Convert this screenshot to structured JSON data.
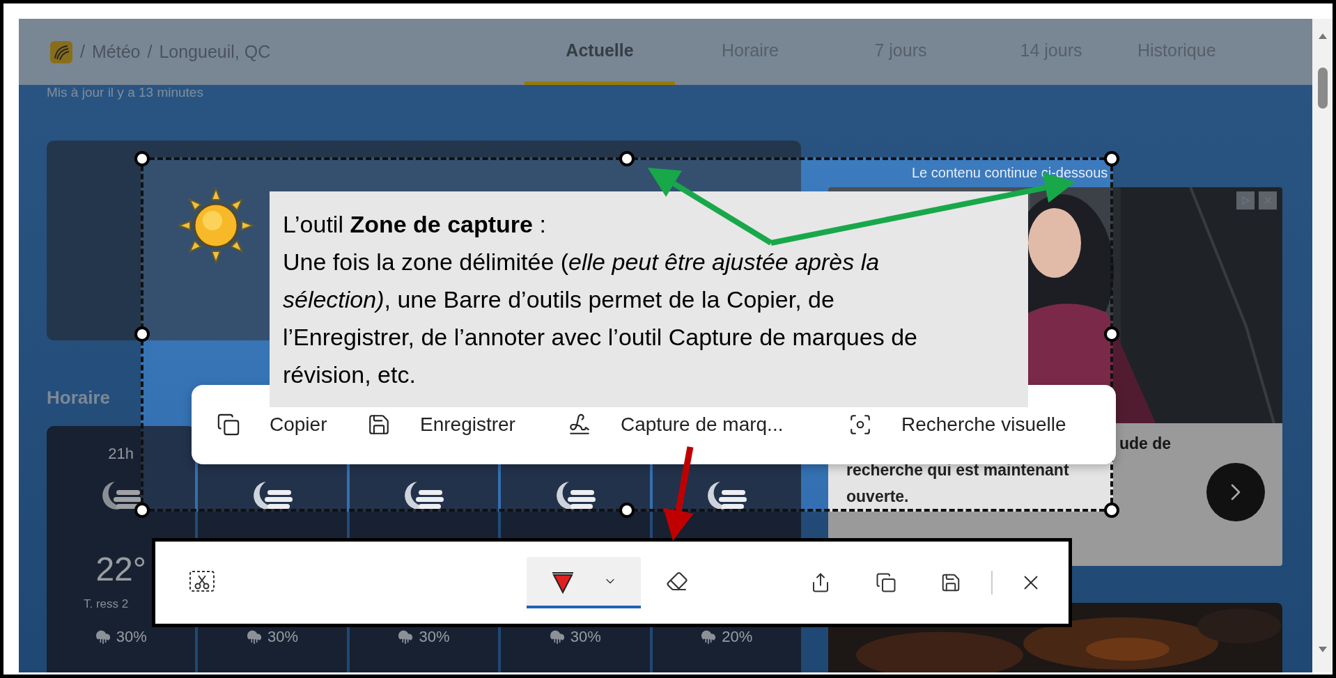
{
  "header": {
    "breadcrumb": {
      "separator": "/",
      "items": [
        "Météo",
        "Longueuil, QC"
      ]
    },
    "tabs": [
      {
        "label": "Actuelle",
        "selected": true
      },
      {
        "label": "Horaire",
        "selected": false
      },
      {
        "label": "7 jours",
        "selected": false
      },
      {
        "label": "14 jours",
        "selected": false
      },
      {
        "label": "Historique",
        "selected": false
      }
    ]
  },
  "updated": "Mis à jour il y a 13 minutes",
  "hourly": {
    "title": "Horaire",
    "hours": [
      {
        "time": "21h",
        "temp": "22°",
        "feels": "T. ress 2",
        "precip": "30%"
      },
      {
        "precip": "30%"
      },
      {
        "precip": "30%"
      },
      {
        "precip": "30%"
      },
      {
        "precip": "20%"
      }
    ]
  },
  "side_note": "Le contenu continue ci-dessous",
  "ad": {
    "lines": [
      "ude de",
      "recherche qui est maintenant",
      "ouverte."
    ]
  },
  "callout": {
    "title": "L’outil **Zone de capture** :",
    "body": "Une fois la zone délimitée (*elle peut être ajustée après la sélection)*, une Barre d’outils permet de la Copier, de l’Enregistrer, de l’annoter avec l’outil Capture de marques de révision, etc."
  },
  "capture_menu": [
    {
      "kind": "copy",
      "label": "Copier"
    },
    {
      "kind": "save",
      "label": "Enregistrer"
    },
    {
      "kind": "markup",
      "label": "Capture de marq..."
    },
    {
      "kind": "visual-search",
      "label": "Recherche visuelle"
    }
  ],
  "snip_toolbar": {
    "tools": [
      {
        "kind": "snip-mode",
        "selected": false
      },
      {
        "kind": "pen",
        "selected": true
      },
      {
        "kind": "eraser",
        "selected": false
      }
    ]
  }
}
